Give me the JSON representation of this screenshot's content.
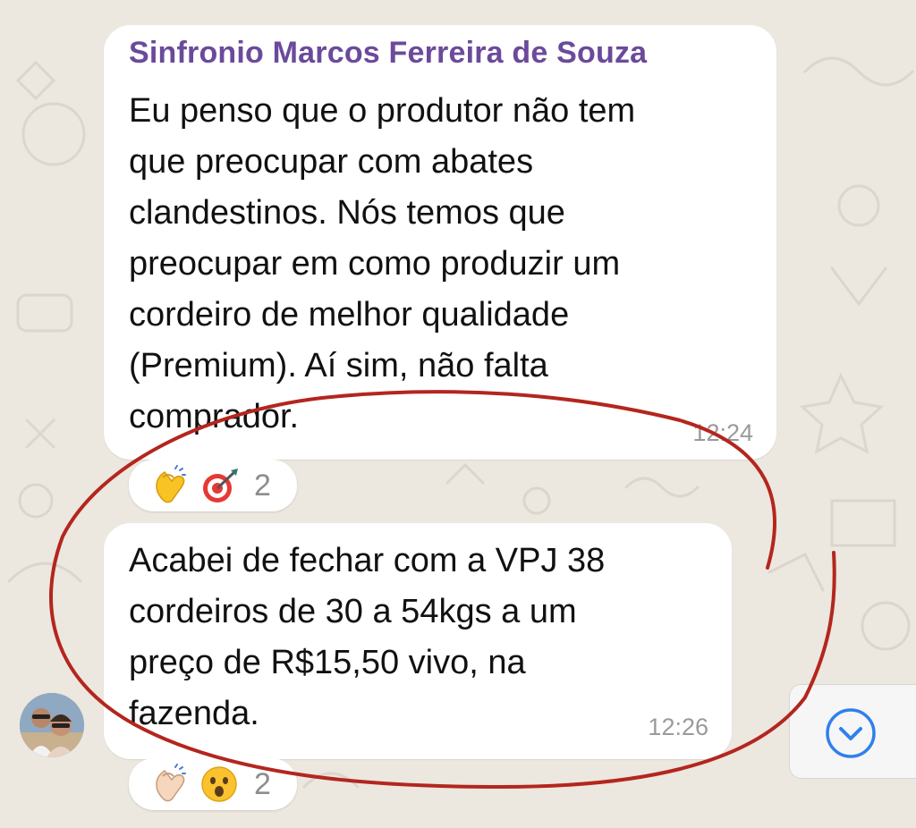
{
  "messages": [
    {
      "sender": "Sinfronio Marcos Ferreira de Souza",
      "text": "Eu penso que o produtor não tem\nque preocupar com abates\nclandestinos. Nós temos que\npreocupar em como produzir um\ncordeiro de melhor qualidade\n(Premium). Aí sim,  não falta\ncomprador.",
      "time": "12:24",
      "reactions": {
        "emojis": [
          "clapping-hands-emoji",
          "bullseye-emoji"
        ],
        "count": "2"
      }
    },
    {
      "text": "Acabei de fechar com a VPJ 38\ncordeiros de 30 a 54kgs a um\npreço de R$15,50 vivo,  na\nfazenda.",
      "time": "12:26",
      "reactions": {
        "emojis": [
          "clapping-hands-emoji",
          "surprised-face-emoji"
        ],
        "count": "2"
      }
    }
  ],
  "colors": {
    "background": "#ece7df",
    "bubble": "#ffffff",
    "sender_name": "#6b4a9b",
    "timestamp": "#9a9a9a",
    "annotation_circle": "#b3261e",
    "scroll_button_icon": "#2f80ed"
  },
  "scroll_button_icon": "chevron-down-circle-icon"
}
